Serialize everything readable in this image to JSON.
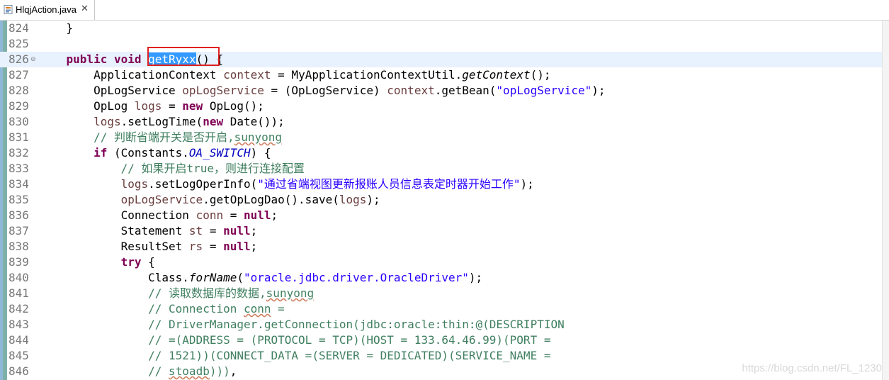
{
  "tab": {
    "label": "HlqjAction.java",
    "close": "✕",
    "icon": "java-file-icon"
  },
  "lines": [
    {
      "n": "824",
      "parts": [
        [
          "    }",
          ""
        ]
      ]
    },
    {
      "n": "825",
      "parts": []
    },
    {
      "n": "826",
      "fold": "⊖",
      "current": true,
      "parts": [
        [
          "    ",
          ""
        ],
        [
          "public",
          "kw"
        ],
        [
          " ",
          ""
        ],
        [
          "void",
          "kw"
        ],
        [
          " ",
          ""
        ],
        [
          "getRyxx",
          "sel"
        ],
        [
          "() {",
          ""
        ]
      ]
    },
    {
      "n": "827",
      "parts": [
        [
          "        ApplicationContext ",
          ""
        ],
        [
          "context",
          "var"
        ],
        [
          " = MyApplicationContextUtil.",
          ""
        ],
        [
          "getContext",
          "it"
        ],
        [
          "();",
          ""
        ]
      ]
    },
    {
      "n": "828",
      "parts": [
        [
          "        OpLogService ",
          ""
        ],
        [
          "opLogService",
          "var"
        ],
        [
          " = (OpLogService) ",
          ""
        ],
        [
          "context",
          "var"
        ],
        [
          ".getBean(",
          ""
        ],
        [
          "\"opLogService\"",
          "str"
        ],
        [
          ");",
          ""
        ]
      ]
    },
    {
      "n": "829",
      "parts": [
        [
          "        OpLog ",
          ""
        ],
        [
          "logs",
          "var"
        ],
        [
          " = ",
          ""
        ],
        [
          "new",
          "kw"
        ],
        [
          " OpLog();",
          ""
        ]
      ]
    },
    {
      "n": "830",
      "parts": [
        [
          "        ",
          ""
        ],
        [
          "logs",
          "var"
        ],
        [
          ".setLogTime(",
          ""
        ],
        [
          "new",
          "kw"
        ],
        [
          " Date());",
          ""
        ]
      ]
    },
    {
      "n": "831",
      "parts": [
        [
          "        ",
          ""
        ],
        [
          "// 判断省端开关是否开启,",
          "cmt"
        ],
        [
          "sunyong",
          "cmt sq"
        ]
      ]
    },
    {
      "n": "832",
      "parts": [
        [
          "        ",
          ""
        ],
        [
          "if",
          "kw"
        ],
        [
          " (Constants.",
          ""
        ],
        [
          "OA_SWITCH",
          "fld"
        ],
        [
          ") {",
          ""
        ]
      ]
    },
    {
      "n": "833",
      "parts": [
        [
          "            ",
          ""
        ],
        [
          "// 如果开启true，则进行连接配置",
          "cmt"
        ]
      ]
    },
    {
      "n": "834",
      "parts": [
        [
          "            ",
          ""
        ],
        [
          "logs",
          "var"
        ],
        [
          ".setLogOperInfo(",
          ""
        ],
        [
          "\"通过省端视图更新报账人员信息表定时器开始工作\"",
          "str"
        ],
        [
          ");",
          ""
        ]
      ]
    },
    {
      "n": "835",
      "parts": [
        [
          "            ",
          ""
        ],
        [
          "opLogService",
          "var"
        ],
        [
          ".getOpLogDao().save(",
          ""
        ],
        [
          "logs",
          "var"
        ],
        [
          ");",
          ""
        ]
      ]
    },
    {
      "n": "836",
      "parts": [
        [
          "            Connection ",
          ""
        ],
        [
          "conn",
          "var"
        ],
        [
          " = ",
          ""
        ],
        [
          "null",
          "kw"
        ],
        [
          ";",
          ""
        ]
      ]
    },
    {
      "n": "837",
      "parts": [
        [
          "            Statement ",
          ""
        ],
        [
          "st",
          "var"
        ],
        [
          " = ",
          ""
        ],
        [
          "null",
          "kw"
        ],
        [
          ";",
          ""
        ]
      ]
    },
    {
      "n": "838",
      "parts": [
        [
          "            ResultSet ",
          ""
        ],
        [
          "rs",
          "var"
        ],
        [
          " = ",
          ""
        ],
        [
          "null",
          "kw"
        ],
        [
          ";",
          ""
        ]
      ]
    },
    {
      "n": "839",
      "parts": [
        [
          "            ",
          ""
        ],
        [
          "try",
          "kw"
        ],
        [
          " {",
          ""
        ]
      ]
    },
    {
      "n": "840",
      "parts": [
        [
          "                Class.",
          ""
        ],
        [
          "forName",
          "it"
        ],
        [
          "(",
          ""
        ],
        [
          "\"oracle.jdbc.driver.OracleDriver\"",
          "str"
        ],
        [
          ");",
          ""
        ]
      ]
    },
    {
      "n": "841",
      "parts": [
        [
          "                ",
          ""
        ],
        [
          "// 读取数据库的数据,",
          "cmt"
        ],
        [
          "sunyong",
          "cmt sq"
        ]
      ]
    },
    {
      "n": "842",
      "parts": [
        [
          "                ",
          ""
        ],
        [
          "// Connection ",
          "cmt"
        ],
        [
          "conn",
          "cmt sq"
        ],
        [
          " =",
          "cmt"
        ]
      ]
    },
    {
      "n": "843",
      "parts": [
        [
          "                ",
          ""
        ],
        [
          "// DriverManager.getConnection(jdbc:oracle:thin:@(DESCRIPTION",
          "cmt"
        ]
      ]
    },
    {
      "n": "844",
      "parts": [
        [
          "                ",
          ""
        ],
        [
          "// =(ADDRESS = (PROTOCOL = TCP)(HOST = 133.64.46.99)(PORT =",
          "cmt"
        ]
      ]
    },
    {
      "n": "845",
      "parts": [
        [
          "                ",
          ""
        ],
        [
          "// 1521))(CONNECT_DATA =(SERVER = DEDICATED)(SERVICE_NAME =",
          "cmt"
        ]
      ]
    },
    {
      "n": "846",
      "parts": [
        [
          "                ",
          ""
        ],
        [
          "// ",
          "cmt"
        ],
        [
          "stoadb",
          "cmt sq"
        ],
        [
          ")))",
          "cmt"
        ],
        [
          ",",
          ""
        ]
      ]
    }
  ],
  "watermark": "https://blog.csdn.net/FL_1230"
}
